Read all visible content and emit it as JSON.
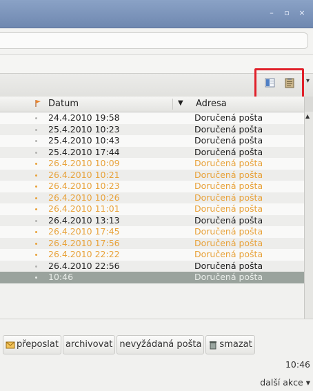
{
  "window": {
    "controls": [
      "–",
      "▫",
      "×"
    ]
  },
  "columns": {
    "date": "Datum",
    "address": "Adresa"
  },
  "messages": [
    {
      "date": "24.4.2010 19:58",
      "folder": "Doručená pošta",
      "unread": false
    },
    {
      "date": "25.4.2010 10:23",
      "folder": "Doručená pošta",
      "unread": false
    },
    {
      "date": "25.4.2010 10:43",
      "folder": "Doručená pošta",
      "unread": false
    },
    {
      "date": "25.4.2010 17:44",
      "folder": "Doručená pošta",
      "unread": false
    },
    {
      "date": "26.4.2010 10:09",
      "folder": "Doručená pošta",
      "unread": true
    },
    {
      "date": "26.4.2010 10:21",
      "folder": "Doručená pošta",
      "unread": true
    },
    {
      "date": "26.4.2010 10:23",
      "folder": "Doručená pošta",
      "unread": true
    },
    {
      "date": "26.4.2010 10:26",
      "folder": "Doručená pošta",
      "unread": true
    },
    {
      "date": "26.4.2010 11:01",
      "folder": "Doručená pošta",
      "unread": true
    },
    {
      "date": "26.4.2010 13:13",
      "folder": "Doručená pošta",
      "unread": false
    },
    {
      "date": "26.4.2010 17:45",
      "folder": "Doručená pošta",
      "unread": true
    },
    {
      "date": "26.4.2010 17:56",
      "folder": "Doručená pošta",
      "unread": true
    },
    {
      "date": "26.4.2010 22:22",
      "folder": "Doručená pošta",
      "unread": true
    },
    {
      "date": "26.4.2010 22:56",
      "folder": "Doručená pošta",
      "unread": false
    },
    {
      "date": "10:46",
      "folder": "Doručená pošta",
      "unread": false,
      "selected": true
    }
  ],
  "actions": {
    "forward": "přeposlat",
    "archive": "archivovat",
    "spam": "nevyžádaná pošta",
    "delete": "smazat"
  },
  "status": {
    "time": "10:46",
    "more_actions": "další akce ▾"
  },
  "colors": {
    "unread": "#e8a23a",
    "highlight_box": "#e0202a",
    "titlebar": "#7b93b9",
    "selected_row": "#9aa39d"
  },
  "icons": {
    "toolbar": [
      "view-layout-icon",
      "clipboard-icon"
    ],
    "flag_column": "flag-icon",
    "forward_button": "forward-mail-icon",
    "delete_button": "trash-icon"
  }
}
